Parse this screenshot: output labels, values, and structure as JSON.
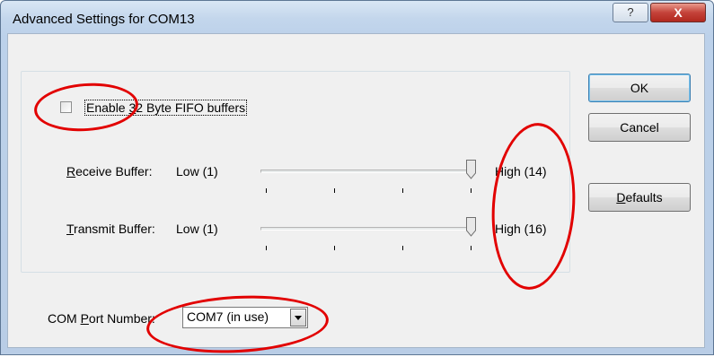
{
  "window": {
    "title": "Advanced Settings for COM13",
    "help_glyph": "?",
    "close_glyph": "X"
  },
  "fifo": {
    "checkbox_checked": false,
    "label_pre": "Enable ",
    "label_accel": "3",
    "label_post": "2 Byte FIFO buffers"
  },
  "receive": {
    "label_accel": "R",
    "label_rest": "eceive Buffer:",
    "low_label": "Low (1)",
    "high_label": "High (14)",
    "value": 14,
    "max": 14
  },
  "transmit": {
    "label_accel": "T",
    "label_rest": "ransmit Buffer:",
    "low_label": "Low (1)",
    "high_label": "High (16)",
    "value": 16,
    "max": 16
  },
  "buttons": {
    "ok": "OK",
    "cancel": "Cancel",
    "defaults_accel": "D",
    "defaults_rest": "efaults"
  },
  "com_port": {
    "label_pre": "COM ",
    "label_accel": "P",
    "label_post": "ort Number:",
    "selected": "COM7 (in use)"
  },
  "colors": {
    "annotation": "#e20000",
    "default_button_border": "#3c7fb1"
  }
}
